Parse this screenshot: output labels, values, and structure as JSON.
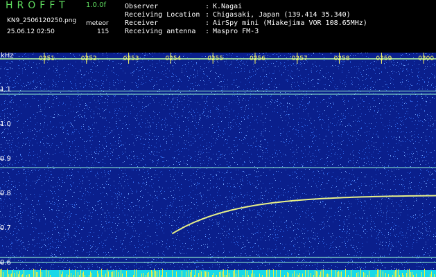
{
  "app": {
    "title": "HROFFT",
    "version": "1.0.0f",
    "filename": "KN9_2506120250.png",
    "mode": "meteor",
    "timestamp": "25.06.12 02:50",
    "count": "115"
  },
  "info": {
    "observer_label": "Observer",
    "observer_value": "K.Nagai",
    "location_label": "Receiving Location",
    "location_value": "Chigasaki, Japan (139.414 35.340)",
    "receiver_label": "Receiver",
    "receiver_value": "AirSpy mini (Miakejima VOR 108.65MHz)",
    "antenna_label": "Receiving antenna",
    "antenna_value": "Maspro FM-3",
    "colon": ":"
  },
  "colors": {
    "background": "#0a1f8c",
    "noise": "#3a7bff",
    "trace": "#e8f088",
    "header_green": "#5fdc5f",
    "time_marks": "#ffff66"
  },
  "chart_data": {
    "type": "heatmap",
    "ylabel": "kHz",
    "ylim": [
      0.59,
      1.2
    ],
    "y_ticks": [
      "1.1",
      "1.0",
      "0.9",
      "0.8",
      "0.7",
      "0.6"
    ],
    "y_tick_values": [
      1.1,
      1.0,
      0.9,
      0.8,
      0.7,
      0.6
    ],
    "time_labels": [
      "0251",
      "0252",
      "0253",
      "0254",
      "0255",
      "0256",
      "0257",
      "0258",
      "0259",
      "0300"
    ],
    "horizontal_lines_khz": [
      1.19,
      1.097,
      1.088,
      0.876,
      0.617,
      0.602
    ],
    "meteor_trace": {
      "start_time": "0254",
      "end_time": "0300",
      "start_khz": 0.685,
      "end_khz": 0.795
    }
  }
}
